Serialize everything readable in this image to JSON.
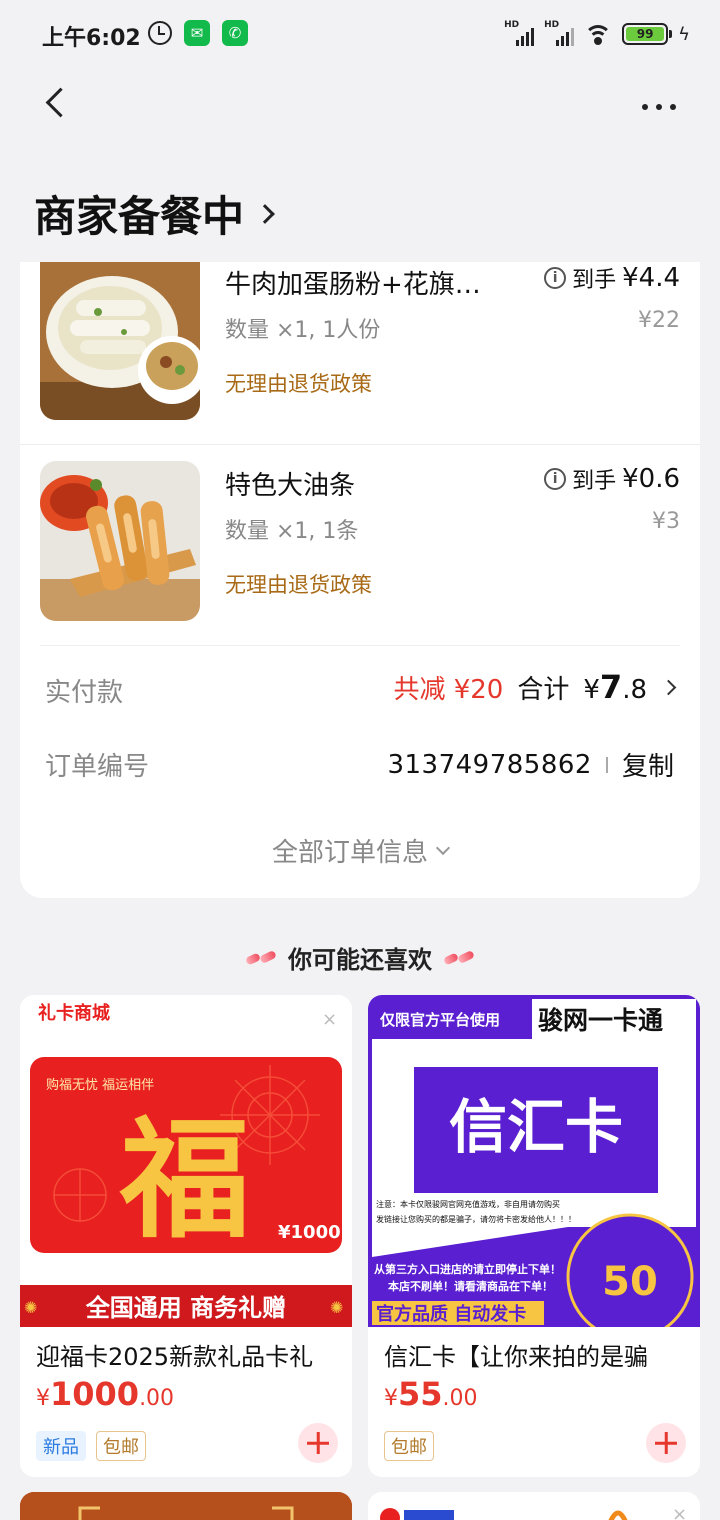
{
  "status_bar": {
    "time": "上午6:02",
    "battery": "99",
    "signal_label_1": "HD",
    "signal_label_2": "HD"
  },
  "header": {
    "title": "商家备餐中"
  },
  "items": [
    {
      "name": "牛肉加蛋肠粉+花旗…",
      "qty": "数量 ×1, 1人份",
      "policy": "无理由退货政策",
      "net_label": "到手",
      "net_price": "¥4.4",
      "orig_price": "¥22"
    },
    {
      "name": "特色大油条",
      "qty": "数量 ×1, 1条",
      "policy": "无理由退货政策",
      "net_label": "到手",
      "net_price": "¥0.6",
      "orig_price": "¥3"
    }
  ],
  "payment": {
    "label": "实付款",
    "discount": "共减 ¥20",
    "total_label": "合计",
    "total_currency": "¥",
    "total_int": "7",
    "total_dec": ".8"
  },
  "order": {
    "label": "订单编号",
    "number": "313749785862",
    "copy_label": "复制"
  },
  "all_info_label": "全部订单信息",
  "recommend": {
    "title": "你可能还喜欢",
    "cards": [
      {
        "shop_tag": "礼卡商城",
        "banner_top": "购福无忧 福运相伴",
        "card_char": "福",
        "card_value": "¥1000",
        "banner_bottom": "全国通用 商务礼赠",
        "name": "迎福卡2025新款礼品卡礼",
        "price_symbol": "¥",
        "price_int": "1000",
        "price_dec": ".00",
        "tags": [
          "新品",
          "包邮"
        ]
      },
      {
        "top_left": "仅限官方平台使用",
        "top_right": "骏网一卡通",
        "card_text": "信汇卡",
        "note_1": "注意：本卡仅限骏网官网充值游戏，非自用请勿购买",
        "note_2": "发链接让您购买的都是骗子，请勿将卡密发给他人！！！",
        "warn_1": "从第三方入口进店的请立即停止下单！",
        "warn_2": "本店不刷单！请看清商品在下单！",
        "badge": "官方品质 自动发卡",
        "face_value": "50",
        "name": "信汇卡【让你来拍的是骗",
        "price_symbol": "¥",
        "price_int": "55",
        "price_dec": ".00",
        "tags": [
          "包邮"
        ]
      }
    ]
  },
  "colors": {
    "accent_red": "#e5372c",
    "policy_brown": "#a86a16",
    "card_purple": "#5a1fd1",
    "gift_red": "#e8201f",
    "gold": "#f7c542"
  }
}
